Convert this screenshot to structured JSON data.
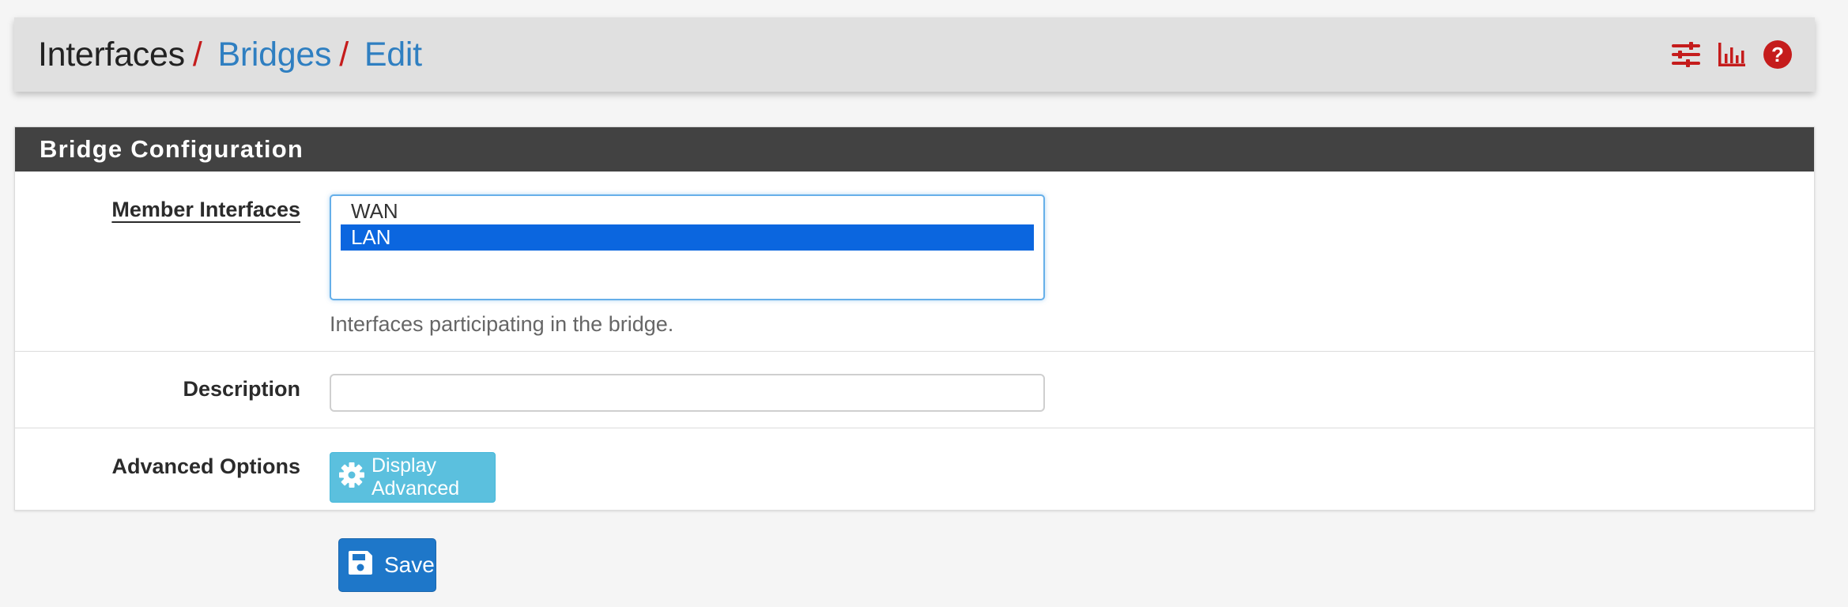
{
  "breadcrumb": {
    "root": "Interfaces",
    "sep": "/",
    "bridges": "Bridges",
    "edit": "Edit"
  },
  "header_icons": [
    "settings-sliders-icon",
    "bar-chart-icon",
    "help-circle-icon"
  ],
  "panel": {
    "title": "Bridge Configuration",
    "member_interfaces": {
      "label": "Member Interfaces",
      "options": [
        "WAN",
        "LAN"
      ],
      "selected": "LAN",
      "help": "Interfaces participating in the bridge."
    },
    "description": {
      "label": "Description",
      "value": ""
    },
    "advanced": {
      "label": "Advanced Options",
      "button": "Display Advanced"
    }
  },
  "save_label": "Save",
  "colors": {
    "accent_red": "#c51c1c",
    "link_blue": "#2f7fc1",
    "panel_header": "#424242",
    "select_blue": "#0b66df",
    "info_button": "#5bc0de",
    "primary_button": "#1e77c9"
  }
}
